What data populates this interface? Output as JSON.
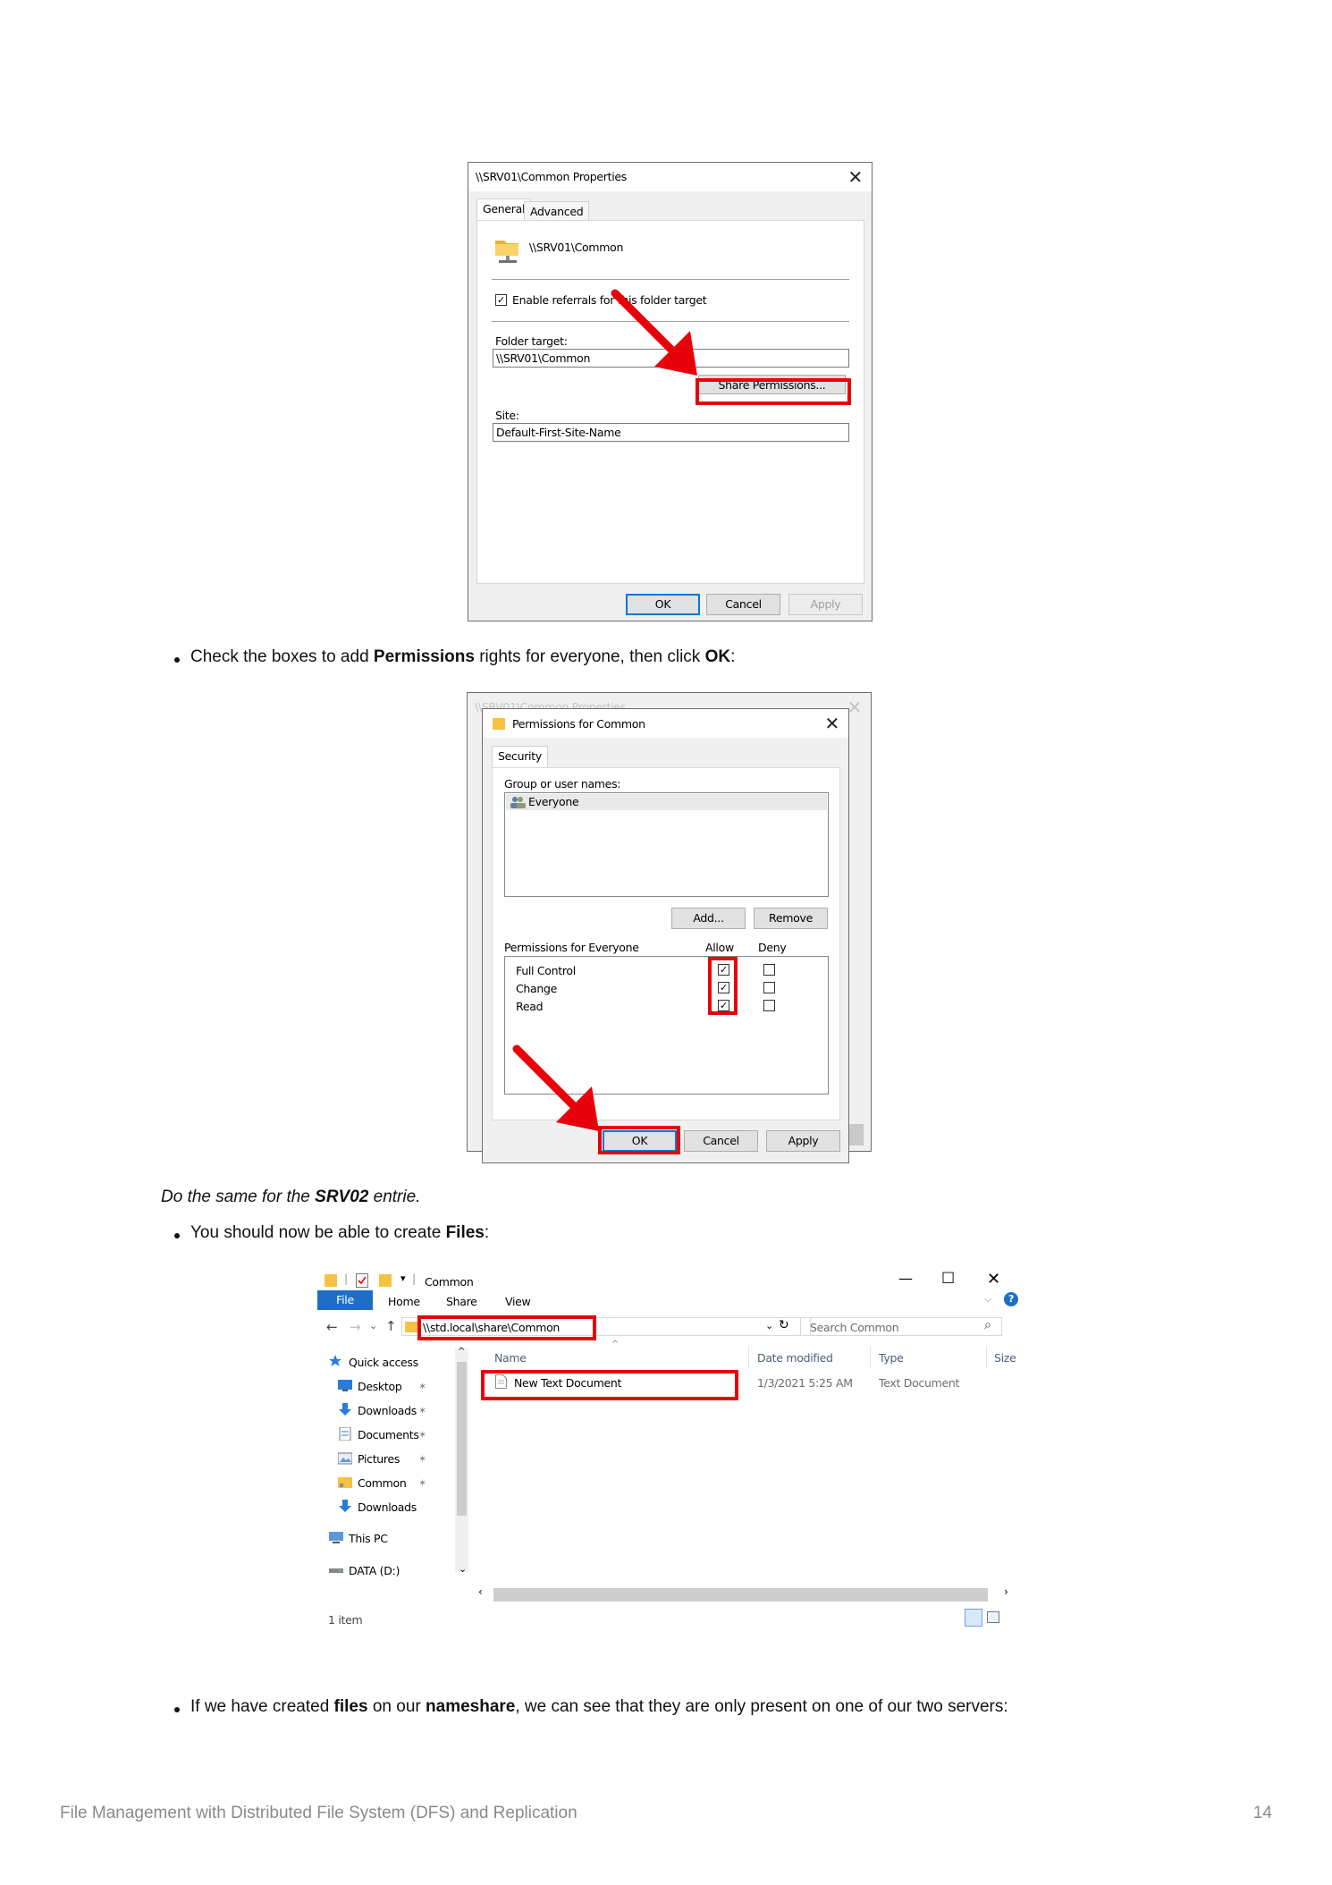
{
  "dialog1": {
    "title": "\\\\SRV01\\Common Properties",
    "tabs": [
      "General",
      "Advanced"
    ],
    "folder_path": "\\\\SRV01\\Common",
    "enable_referrals_label": "Enable referrals for this folder target",
    "enable_referrals_checked": true,
    "folder_target_label": "Folder target:",
    "folder_target_value": "\\\\SRV01\\Common",
    "share_permissions_button": "Share Permissions...",
    "site_label": "Site:",
    "site_value": "Default-First-Site-Name",
    "ok": "OK",
    "cancel": "Cancel",
    "apply": "Apply"
  },
  "step1": {
    "text_before": "Check the boxes to add ",
    "bold1": "Permissions",
    "text_mid": " rights for everyone, then click ",
    "bold2": "OK",
    "text_after": ":"
  },
  "dialog2": {
    "behind_title": "\\\\SRV01\\Common Properties",
    "title": "Permissions for Common",
    "tab": "Security",
    "group_label": "Group or user names:",
    "users": [
      "Everyone"
    ],
    "add_button": "Add...",
    "remove_button": "Remove",
    "perm_label": "Permissions for Everyone",
    "allow_label": "Allow",
    "deny_label": "Deny",
    "permissions": [
      {
        "name": "Full Control",
        "allow": true,
        "deny": false
      },
      {
        "name": "Change",
        "allow": true,
        "deny": false
      },
      {
        "name": "Read",
        "allow": true,
        "deny": false
      }
    ],
    "ok": "OK",
    "cancel": "Cancel",
    "apply": "Apply"
  },
  "note": {
    "text_before": "Do the same for the ",
    "bold": "SRV02",
    "text_after": " entrie."
  },
  "step2": {
    "text_before": "You should now be able to create ",
    "bold": "Files",
    "text_after": ":"
  },
  "explorer": {
    "title": "Common",
    "ribbon_tabs": [
      "File",
      "Home",
      "Share",
      "View"
    ],
    "address": "\\\\std.local\\share\\Common",
    "search_placeholder": "Search Common",
    "columns": [
      "Name",
      "Date modified",
      "Type",
      "Size"
    ],
    "files": [
      {
        "name": "New Text Document",
        "date": "1/3/2021 5:25 AM",
        "type": "Text Document",
        "size": ""
      }
    ],
    "nav": [
      {
        "label": "Quick access",
        "icon": "star-icon",
        "pinned": false
      },
      {
        "label": "Desktop",
        "icon": "desktop-icon",
        "pinned": true
      },
      {
        "label": "Downloads",
        "icon": "download-icon",
        "pinned": true
      },
      {
        "label": "Documents",
        "icon": "documents-icon",
        "pinned": true
      },
      {
        "label": "Pictures",
        "icon": "pictures-icon",
        "pinned": true
      },
      {
        "label": "Common",
        "icon": "folder-icon",
        "pinned": true
      },
      {
        "label": "Downloads",
        "icon": "download-icon",
        "pinned": false
      },
      {
        "label": "This PC",
        "icon": "pc-icon",
        "pinned": false
      },
      {
        "label": "DATA (D:)",
        "icon": "drive-icon",
        "pinned": false
      }
    ],
    "status": "1 item"
  },
  "step3": {
    "text_before": "If we have created ",
    "bold1": "files",
    "text_mid": " on our ",
    "bold2": "nameshare",
    "text_after": ", we can see that they are only present on one of our two servers:"
  },
  "footer": {
    "title": "File Management with Distributed File System (DFS) and Replication",
    "page": "14"
  },
  "colors": {
    "highlight_red": "#e8000b",
    "file_tab_blue": "#1e6ec8",
    "folder_yellow": "#f5c242"
  }
}
